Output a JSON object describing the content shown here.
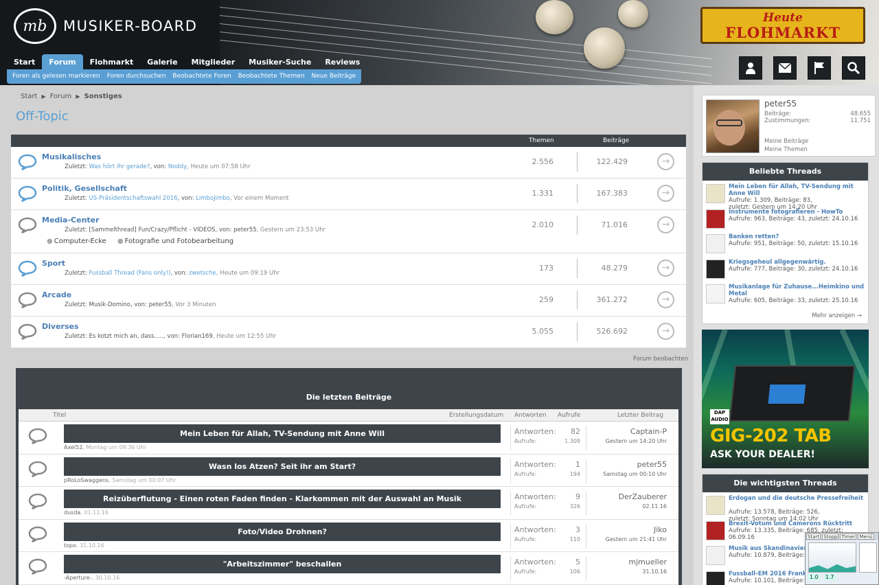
{
  "header": {
    "site_name": "MUSIKER-BOARD",
    "logo_mark": "mb",
    "promo_line1": "Heute",
    "promo_line2": "FLOHMARKT"
  },
  "nav": {
    "tabs": [
      "Start",
      "Forum",
      "Flohmarkt",
      "Galerie",
      "Mitglieder",
      "Musiker-Suche",
      "Reviews"
    ],
    "active": "Forum"
  },
  "subnav": [
    "Foren als gelesen markieren",
    "Foren durchsuchen",
    "Beobachtete Foren",
    "Beobachtete Themen",
    "Neue Beiträge"
  ],
  "header_icons": [
    "user-icon",
    "mail-icon",
    "flag-icon",
    "search-icon"
  ],
  "breadcrumb": [
    "Start",
    "Forum",
    "Sonstiges"
  ],
  "page_title": "Off-Topic",
  "forum_table": {
    "col_threads": "Themen",
    "col_posts": "Beiträge",
    "rows": [
      {
        "name": "Musikalisches",
        "prefix": "Zuletzt:",
        "thread": "Was hört ihr gerade?",
        "by": ", von:",
        "user": "Noddy",
        "time": ", Heute um 07:58 Uhr",
        "threads": "2.556",
        "posts": "122.429",
        "unread": true,
        "linked": true
      },
      {
        "name": "Politik, Gesellschaft",
        "prefix": "Zuletzt:",
        "thread": "US-Präsidentschaftswahl 2016",
        "by": ", von:",
        "user": "LimboJimbo",
        "time": ", Vor einem Moment",
        "threads": "1.331",
        "posts": "167.383",
        "unread": true,
        "linked": true
      },
      {
        "name": "Media-Center",
        "prefix": "Zuletzt:",
        "thread": "[Sammelthread] Fun/Crazy/Pflicht - VIDEOS",
        "by": ", von:",
        "user": "peter55",
        "time": ", Gestern um 23:53 Uhr",
        "threads": "2.010",
        "posts": "71.016",
        "unread": false,
        "linked": false,
        "subforums": [
          "Computer-Ecke",
          "Fotografie und Fotobearbeitung"
        ]
      },
      {
        "name": "Sport",
        "prefix": "Zuletzt:",
        "thread": "Fussball Thread (Fans only!)",
        "by": ", von:",
        "user": "zwetsche",
        "time": ", Heute um 09:19 Uhr",
        "threads": "173",
        "posts": "48.279",
        "unread": true,
        "linked": true
      },
      {
        "name": "Arcade",
        "prefix": "Zuletzt:",
        "thread": "Musik-Domino",
        "by": ", von:",
        "user": "peter55",
        "time": ", Vor 3 Minuten",
        "threads": "259",
        "posts": "361.272",
        "unread": false,
        "linked": false
      },
      {
        "name": "Diverses",
        "prefix": "Zuletzt:",
        "thread": "Es kotzt mich an, dass.....",
        "by": ", von:",
        "user": "Florian169",
        "time": ", Heute um 12:55 Uhr",
        "threads": "5.055",
        "posts": "526.692",
        "unread": false,
        "linked": false
      }
    ]
  },
  "watch_forum": "Forum beobachten",
  "latest": {
    "title": "Die letzten Beiträge",
    "col_title": "Titel",
    "col_created": "Erstellungsdatum",
    "col_replies": "Antworten",
    "col_views": "Aufrufe",
    "col_last": "Letzter Beitrag",
    "label_replies": "Antworten:",
    "label_views": "Aufrufe:",
    "rows": [
      {
        "title": "Mein Leben für Allah, TV-Sendung mit Anne Will",
        "author": "Axel52",
        "date": ", Montag um 09:36 Uhr",
        "replies": "82",
        "views": "1.309",
        "last_user": "Captain-P",
        "last_time": "Gestern um 14:20 Uhr"
      },
      {
        "title": "Wasn los Atzen? Seit ihr am Start?",
        "author": "pRoLoSwaggens",
        "date": ", Samstag um 00:07 Uhr",
        "replies": "1",
        "views": "194",
        "last_user": "peter55",
        "last_time": "Samstag um 00:10 Uhr"
      },
      {
        "title": "Reizüberflutung - Einen roten Faden finden - Klarkommen mit der Auswahl an Musik",
        "author": "dusda",
        "date": ", 01.11.16",
        "replies": "9",
        "views": "326",
        "last_user": "DerZauberer",
        "last_time": "02.11.16"
      },
      {
        "title": "Foto/Video Drohnen?",
        "author": "topo",
        "date": ", 31.10.16",
        "replies": "3",
        "views": "110",
        "last_user": "Jiko",
        "last_time": "Gestern um 21:41 Uhr"
      },
      {
        "title": "\"Arbeitszimmer\" beschallen",
        "author": "-Aperture-",
        "date": ", 30.10.16",
        "replies": "5",
        "views": "106",
        "last_user": "mjmueller",
        "last_time": "31.10.16"
      }
    ]
  },
  "profile": {
    "name": "peter55",
    "label_posts": "Beiträge:",
    "posts": "48.655",
    "label_likes": "Zustimmungen:",
    "likes": "11.751",
    "link1": "Meine Beiträge",
    "link2": "Meine Themen"
  },
  "popular": {
    "title": "Beliebte Threads",
    "more": "Mehr anzeigen",
    "items": [
      {
        "title": "Mein Leben für Allah, TV-Sendung mit Anne Will",
        "stats": "Aufrufe: 1.309, Beiträge: 83,",
        "stats2": "zuletzt: Gestern um 14:20 Uhr"
      },
      {
        "title": "Instrumente fotografieren - HowTo",
        "stats": "Aufrufe: 963, Beiträge: 43, zuletzt: 24.10.16",
        "stats2": ""
      },
      {
        "title": "Banken retten?",
        "stats": "Aufrufe: 951, Beiträge: 50, zuletzt: 15.10.16",
        "stats2": ""
      },
      {
        "title": "Kriegsgeheul allgegenwärtig.",
        "stats": "Aufrufe: 777, Beiträge: 30, zuletzt: 24.10.16",
        "stats2": ""
      },
      {
        "title": "Musikanlage für Zuhause...Heimkino und Metal",
        "stats": "Aufrufe: 605, Beiträge: 33, zuletzt: 25.10.16",
        "stats2": ""
      }
    ]
  },
  "ad": {
    "brand": "DAP AUDIO",
    "product": "GIG-202 TAB",
    "tagline": "ASK YOUR DEALER!"
  },
  "important": {
    "title": "Die wichtigsten Threads",
    "items": [
      {
        "title": "Erdogan und die deutsche Pressefreiheit",
        "stats": "Aufrufe: 13.578, Beiträge: 526,",
        "stats2": "zuletzt: Sonntag um 14:02 Uhr"
      },
      {
        "title": "Brexit-Votum und Camerons Rücktritt",
        "stats": "Aufrufe: 13.335, Beiträge: 685, zuletzt: 06.09.16",
        "stats2": ""
      },
      {
        "title": "Musik aus Skandinavien",
        "stats": "Aufrufe: 10.879, Beiträge: 7",
        "stats2": ""
      },
      {
        "title": "Fussball-EM 2016 Frankreich",
        "stats": "Aufrufe: 10.101, Beiträge: 2",
        "stats2": ""
      }
    ]
  },
  "widget": {
    "tabs": [
      "Start",
      "Stopp",
      "Timer",
      "Menü"
    ],
    "val1": "1.0",
    "val2": "1.7"
  }
}
